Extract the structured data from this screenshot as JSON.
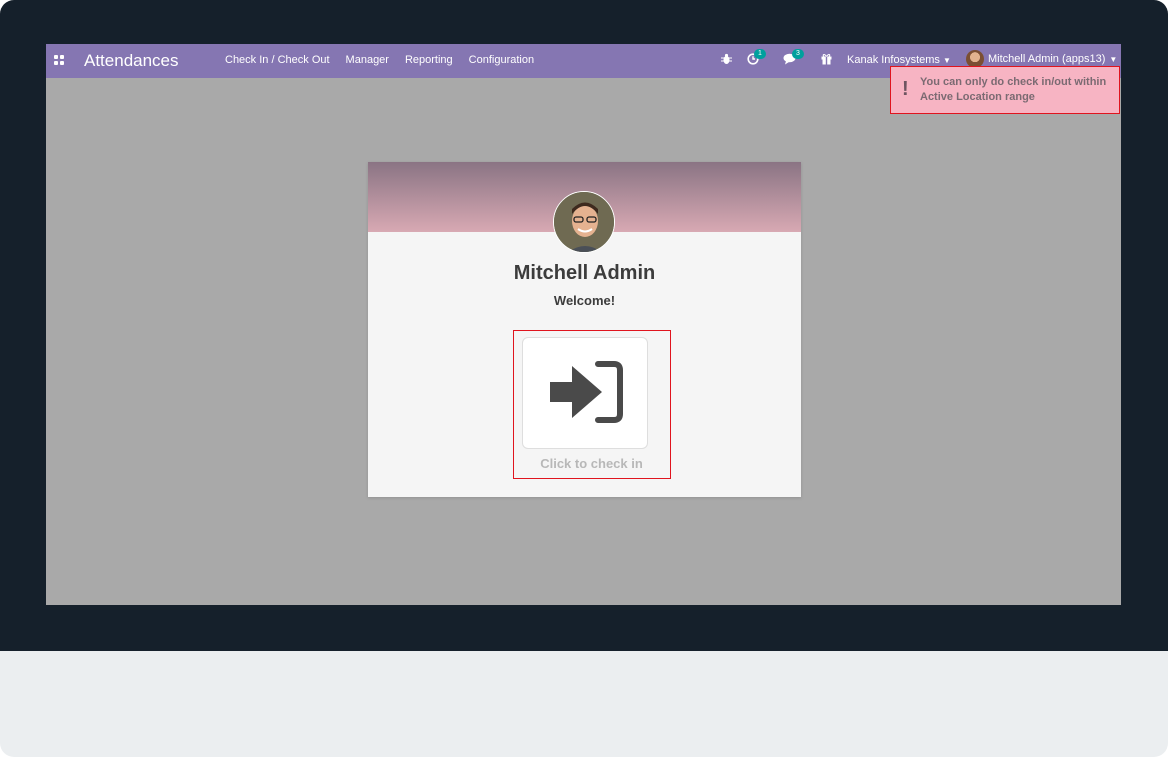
{
  "app": {
    "title": "Attendances"
  },
  "nav": {
    "menu": [
      "Check In / Check Out",
      "Manager",
      "Reporting",
      "Configuration"
    ],
    "activity_count": "1",
    "messages_count": "3",
    "company": "Kanak Infosystems",
    "user": "Mitchell Admin (apps13)"
  },
  "toast": {
    "message": "You can only do check in/out within Active Location range"
  },
  "card": {
    "employee_name": "Mitchell Admin",
    "welcome": "Welcome!",
    "checkin_label": "Click to check in"
  },
  "colors": {
    "navbar": "#8576b2",
    "toast_bg": "#f7b4c3",
    "highlight_border": "#e0141e",
    "badge": "#00a09d"
  },
  "icons": {
    "apps": "apps-grid-icon",
    "bug": "bug-icon",
    "activity": "clock-icon",
    "messages": "chat-icon",
    "gift": "gift-icon",
    "checkin": "sign-in-icon"
  }
}
